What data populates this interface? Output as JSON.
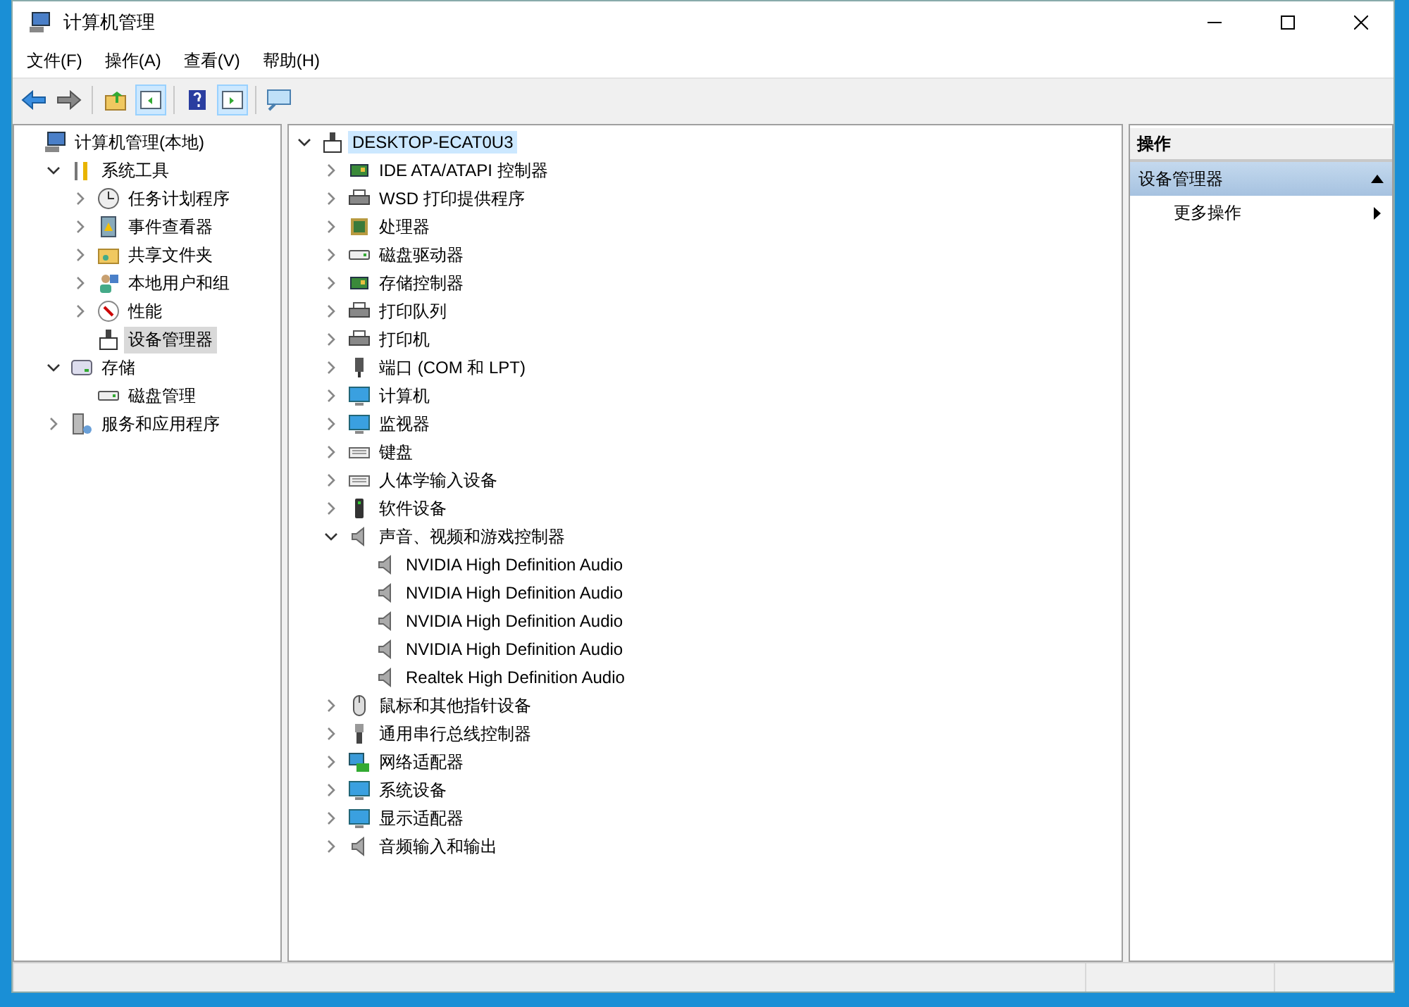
{
  "window": {
    "title": "计算机管理"
  },
  "menu": [
    "文件(F)",
    "操作(A)",
    "查看(V)",
    "帮助(H)"
  ],
  "toolbar": [
    {
      "kind": "back",
      "pressed": false
    },
    {
      "kind": "forward",
      "pressed": false
    },
    {
      "kind": "sep"
    },
    {
      "kind": "up",
      "pressed": false
    },
    {
      "kind": "tree",
      "pressed": true
    },
    {
      "kind": "sep"
    },
    {
      "kind": "help",
      "pressed": false
    },
    {
      "kind": "pane",
      "pressed": true
    },
    {
      "kind": "sep"
    },
    {
      "kind": "scan",
      "pressed": false
    }
  ],
  "console_tree": [
    {
      "label": "计算机管理(本地)",
      "kind": "computer",
      "selected": false,
      "children": [
        {
          "label": "系统工具",
          "kind": "tools",
          "expanded": true,
          "selected": false,
          "children": [
            {
              "label": "任务计划程序",
              "kind": "clock",
              "expanded": false,
              "selected": false
            },
            {
              "label": "事件查看器",
              "kind": "event",
              "expanded": false,
              "selected": false
            },
            {
              "label": "共享文件夹",
              "kind": "folder",
              "expanded": false,
              "selected": false
            },
            {
              "label": "本地用户和组",
              "kind": "users",
              "expanded": false,
              "selected": false
            },
            {
              "label": "性能",
              "kind": "gauge",
              "expanded": false,
              "selected": false
            },
            {
              "label": "设备管理器",
              "kind": "device",
              "selected": true
            }
          ]
        },
        {
          "label": "存储",
          "kind": "storage",
          "expanded": true,
          "selected": false,
          "children": [
            {
              "label": "磁盘管理",
              "kind": "disk",
              "selected": false
            }
          ]
        },
        {
          "label": "服务和应用程序",
          "kind": "services",
          "expanded": false,
          "selected": false
        }
      ]
    }
  ],
  "device_tree": {
    "label": "DESKTOP-ECAT0U3",
    "kind": "device",
    "expanded": true,
    "selected": true,
    "children": [
      {
        "label": "IDE ATA/ATAPI 控制器",
        "kind": "chip",
        "expanded": false
      },
      {
        "label": "WSD 打印提供程序",
        "kind": "printer",
        "expanded": false
      },
      {
        "label": "处理器",
        "kind": "cpu",
        "expanded": false
      },
      {
        "label": "磁盘驱动器",
        "kind": "disk",
        "expanded": false
      },
      {
        "label": "存储控制器",
        "kind": "chip",
        "expanded": false
      },
      {
        "label": "打印队列",
        "kind": "printer",
        "expanded": false
      },
      {
        "label": "打印机",
        "kind": "printer",
        "expanded": false
      },
      {
        "label": "端口 (COM 和 LPT)",
        "kind": "port",
        "expanded": false
      },
      {
        "label": "计算机",
        "kind": "monitor",
        "expanded": false
      },
      {
        "label": "监视器",
        "kind": "monitor",
        "expanded": false
      },
      {
        "label": "键盘",
        "kind": "keyboard",
        "expanded": false
      },
      {
        "label": "人体学输入设备",
        "kind": "keyboard",
        "expanded": false
      },
      {
        "label": "软件设备",
        "kind": "phone",
        "expanded": false
      },
      {
        "label": "声音、视频和游戏控制器",
        "kind": "speaker",
        "expanded": true,
        "children": [
          {
            "label": "NVIDIA High Definition Audio",
            "kind": "speaker"
          },
          {
            "label": "NVIDIA High Definition Audio",
            "kind": "speaker"
          },
          {
            "label": "NVIDIA High Definition Audio",
            "kind": "speaker"
          },
          {
            "label": "NVIDIA High Definition Audio",
            "kind": "speaker"
          },
          {
            "label": "Realtek High Definition Audio",
            "kind": "speaker"
          }
        ]
      },
      {
        "label": "鼠标和其他指针设备",
        "kind": "mouse",
        "expanded": false
      },
      {
        "label": "通用串行总线控制器",
        "kind": "usb",
        "expanded": false
      },
      {
        "label": "网络适配器",
        "kind": "network",
        "expanded": false
      },
      {
        "label": "系统设备",
        "kind": "monitor",
        "expanded": false
      },
      {
        "label": "显示适配器",
        "kind": "monitor",
        "expanded": false
      },
      {
        "label": "音频输入和输出",
        "kind": "speaker",
        "expanded": false
      }
    ]
  },
  "actions": {
    "header": "操作",
    "section": {
      "title": "设备管理器",
      "expanded": true,
      "items": [
        "更多操作"
      ]
    }
  }
}
